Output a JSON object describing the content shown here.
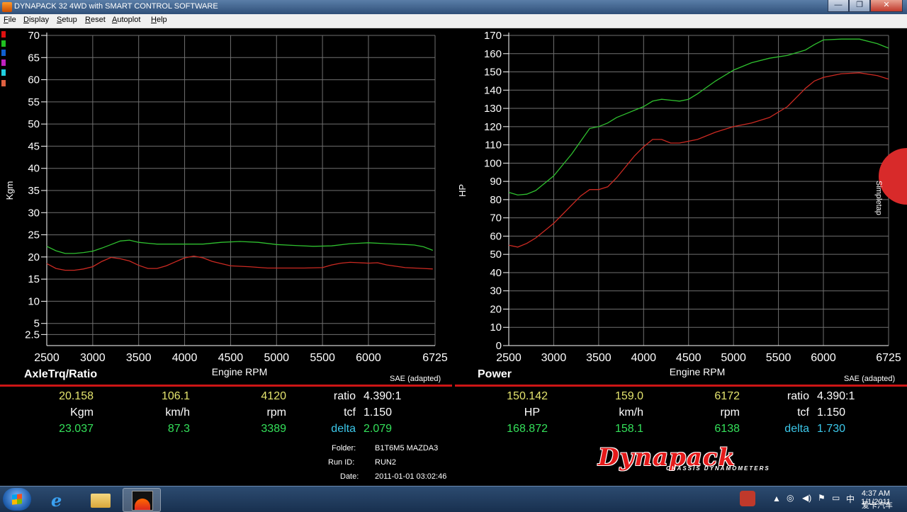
{
  "window": {
    "title": "DYNAPACK 32 4WD with SMART CONTROL SOFTWARE",
    "minimize": "—",
    "maximize": "❐",
    "close": "✕"
  },
  "menu": [
    {
      "u": "F",
      "r": "ile"
    },
    {
      "u": "D",
      "r": "isplay"
    },
    {
      "u": "S",
      "r": "etup"
    },
    {
      "u": "R",
      "r": "eset"
    },
    {
      "u": "A",
      "r": "utoplot"
    },
    {
      "u": "H",
      "r": "elp"
    }
  ],
  "colors": {
    "red": "#cc2a22",
    "green": "#2fc02f",
    "accent_red": "#cc1515",
    "yellow": "#e4e46e",
    "cyan": "#3cc8ea"
  },
  "channel_swatches": [
    "#e01010",
    "#20c020",
    "#1060d0",
    "#c020c0",
    "#20d0e0",
    "#e06040"
  ],
  "chart_data": [
    {
      "type": "line",
      "title": "AxleTrq/Ratio",
      "subtitle": "SAE (adapted)",
      "xlabel": "Engine RPM",
      "ylabel": "Kgm",
      "xlim": [
        2500,
        6725
      ],
      "ylim": [
        0,
        70
      ],
      "xticks": [
        2500,
        3000,
        3500,
        4000,
        4500,
        5000,
        5500,
        6000,
        6725
      ],
      "yticks": [
        5,
        10,
        15,
        20,
        25,
        30,
        35,
        40,
        45,
        50,
        55,
        60,
        65,
        70
      ],
      "yticks_extra": [
        "2.5"
      ],
      "grid": true,
      "series": [
        {
          "color": "#cc2a22",
          "x": [
            2500,
            2600,
            2700,
            2800,
            2900,
            3000,
            3100,
            3200,
            3300,
            3400,
            3500,
            3600,
            3700,
            3800,
            3900,
            4000,
            4100,
            4200,
            4300,
            4400,
            4500,
            4700,
            4900,
            5100,
            5300,
            5500,
            5600,
            5700,
            5800,
            5900,
            6000,
            6100,
            6200,
            6300,
            6400,
            6500,
            6600,
            6700
          ],
          "y": [
            18.5,
            17.4,
            17.0,
            17.0,
            17.3,
            17.8,
            19.0,
            19.9,
            19.6,
            19.1,
            18.1,
            17.4,
            17.4,
            18.0,
            18.9,
            19.8,
            20.2,
            19.8,
            19.0,
            18.5,
            18.0,
            17.8,
            17.5,
            17.5,
            17.5,
            17.6,
            18.2,
            18.6,
            18.8,
            18.7,
            18.6,
            18.7,
            18.2,
            17.9,
            17.6,
            17.5,
            17.4,
            17.3
          ]
        },
        {
          "color": "#2fc02f",
          "x": [
            2500,
            2600,
            2700,
            2800,
            2900,
            3000,
            3100,
            3200,
            3300,
            3400,
            3500,
            3600,
            3700,
            3800,
            3900,
            4000,
            4200,
            4400,
            4600,
            4800,
            5000,
            5200,
            5400,
            5600,
            5800,
            6000,
            6200,
            6400,
            6500,
            6600,
            6700
          ],
          "y": [
            22.4,
            21.4,
            20.8,
            20.8,
            21.0,
            21.3,
            22.0,
            22.8,
            23.6,
            23.8,
            23.3,
            23.1,
            22.9,
            22.9,
            22.9,
            22.9,
            22.9,
            23.3,
            23.5,
            23.3,
            22.8,
            22.6,
            22.4,
            22.5,
            23.0,
            23.2,
            23.0,
            22.8,
            22.7,
            22.3,
            21.5
          ]
        }
      ]
    },
    {
      "type": "line",
      "title": "Power",
      "subtitle": "SAE (adapted)",
      "xlabel": "Engine RPM",
      "ylabel": "HP",
      "xlim": [
        2500,
        6725
      ],
      "ylim": [
        0,
        170
      ],
      "xticks": [
        2500,
        3000,
        3500,
        4000,
        4500,
        5000,
        5500,
        6000,
        6725
      ],
      "yticks": [
        0,
        10,
        20,
        30,
        40,
        50,
        60,
        70,
        80,
        90,
        100,
        110,
        120,
        130,
        140,
        150,
        160,
        170
      ],
      "grid": true,
      "series": [
        {
          "color": "#cc2a22",
          "x": [
            2500,
            2600,
            2700,
            2800,
            2900,
            3000,
            3100,
            3200,
            3300,
            3400,
            3500,
            3600,
            3700,
            3800,
            3900,
            4000,
            4100,
            4200,
            4300,
            4400,
            4600,
            4800,
            5000,
            5200,
            5400,
            5600,
            5700,
            5800,
            5900,
            6000,
            6200,
            6400,
            6600,
            6725
          ],
          "y": [
            55,
            54,
            56,
            59,
            63,
            67,
            72,
            77,
            82,
            85.5,
            85.5,
            87,
            92,
            98,
            104,
            109,
            113,
            113,
            111,
            111,
            113,
            117,
            120,
            122,
            125,
            131,
            136,
            141,
            145,
            147,
            149,
            149.5,
            148,
            146
          ]
        },
        {
          "color": "#2fc02f",
          "x": [
            2500,
            2600,
            2700,
            2800,
            2900,
            3000,
            3100,
            3200,
            3300,
            3400,
            3500,
            3600,
            3700,
            3800,
            3900,
            4000,
            4100,
            4200,
            4300,
            4400,
            4500,
            4600,
            4800,
            5000,
            5200,
            5400,
            5600,
            5800,
            5900,
            6000,
            6200,
            6400,
            6600,
            6725
          ],
          "y": [
            84,
            82.5,
            83,
            85,
            89,
            93,
            99,
            105,
            112,
            119,
            120,
            122,
            125,
            127,
            129,
            131,
            134,
            135,
            134.5,
            134,
            135,
            138,
            145,
            151,
            155,
            157.5,
            159,
            162,
            165,
            167.5,
            168,
            168,
            165.5,
            163
          ]
        }
      ]
    }
  ],
  "left_axis_ticks": [
    "2.5",
    "5",
    "10",
    "15",
    "20",
    "25",
    "30",
    "35",
    "40",
    "45",
    "50",
    "55",
    "60",
    "65",
    "70"
  ],
  "right_axis_ticks": [
    "0",
    "10",
    "20",
    "30",
    "40",
    "50",
    "60",
    "70",
    "80",
    "90",
    "100",
    "110",
    "120",
    "130",
    "140",
    "150",
    "160",
    "170"
  ],
  "x_axis_ticks": [
    "2500",
    "3000",
    "3500",
    "4000",
    "4500",
    "5000",
    "5500",
    "6000",
    "6725"
  ],
  "left_axis_label": "Kgm",
  "right_axis_label": "HP",
  "x_axis_label": "Engine RPM",
  "left_panel": {
    "title": "AxleTrq/Ratio",
    "sae": "SAE (adapted)",
    "row1": {
      "v1": "20.158",
      "v2": "106.1",
      "v3": "4120",
      "label": "ratio",
      "value": "4.390:1"
    },
    "row2": {
      "u1": "Kgm",
      "u2": "km/h",
      "u3": "rpm",
      "label": "tcf",
      "value": "1.150"
    },
    "row3": {
      "v1": "23.037",
      "v2": "87.3",
      "v3": "3389",
      "label": "delta",
      "value": "2.079"
    }
  },
  "right_panel": {
    "title": "Power",
    "sae": "SAE (adapted)",
    "row1": {
      "v1": "150.142",
      "v2": "159.0",
      "v3": "6172",
      "label": "ratio",
      "value": "4.390:1"
    },
    "row2": {
      "u1": "HP",
      "u2": "km/h",
      "u3": "rpm",
      "label": "tcf",
      "value": "1.150"
    },
    "row3": {
      "v1": "168.872",
      "v2": "158.1",
      "v3": "6138",
      "label": "delta",
      "value": "1.730"
    }
  },
  "info": {
    "folder_label": "Folder:",
    "folder": "B1T6M5 MAZDA3",
    "run_label": "Run ID:",
    "run": "RUN2",
    "date_label": "Date:",
    "date": "2011-01-01 03:02:46"
  },
  "logo": {
    "name": "Dynapack",
    "sub": "CHASSIS DYNAMOMETERS"
  },
  "simpletap": "Simpletap",
  "taskbar": {
    "clock_time": "4:37 AM",
    "clock_date": "1/1/2011",
    "watermark": "爱卡汽车"
  }
}
